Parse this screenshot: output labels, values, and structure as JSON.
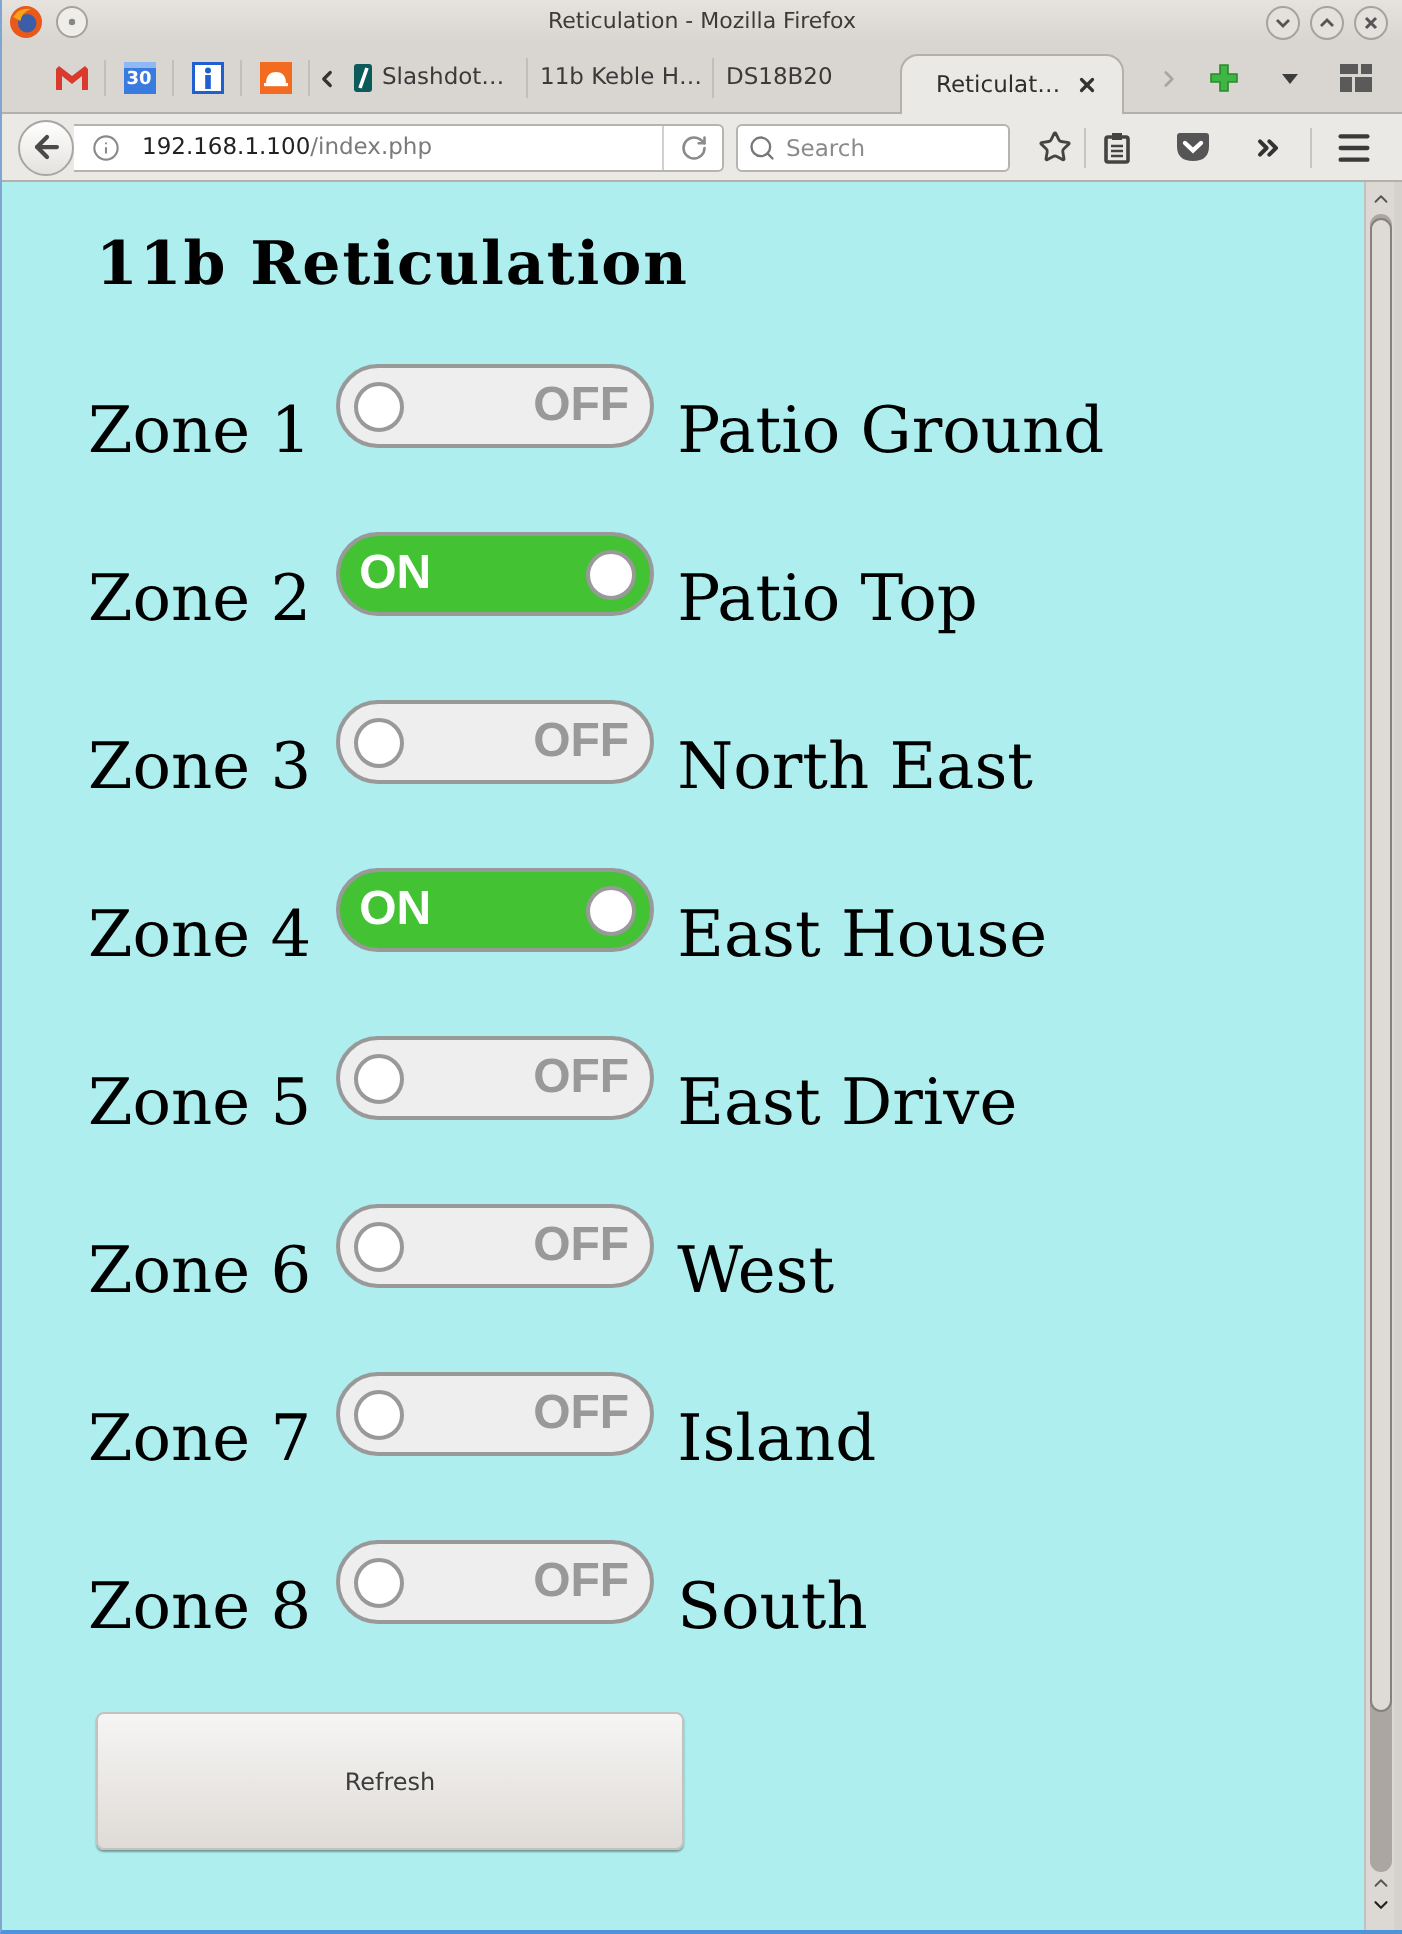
{
  "window": {
    "title": "Reticulation - Mozilla Firefox"
  },
  "pinned_tabs": [
    {
      "kind": "mail"
    },
    {
      "kind": "calendar",
      "label": "30"
    },
    {
      "kind": "info"
    },
    {
      "kind": "helmet"
    }
  ],
  "tabs": [
    {
      "label": "Slashdot…",
      "has_icon": true,
      "selected": false
    },
    {
      "label": "11b Keble H…",
      "has_icon": false,
      "selected": false
    },
    {
      "label": "DS18B20",
      "has_icon": false,
      "selected": false
    },
    {
      "label": "Reticulat…",
      "has_icon": false,
      "selected": true
    }
  ],
  "address_bar": {
    "host": "192.168.1.100",
    "path": "/index.php"
  },
  "search": {
    "placeholder": "Search"
  },
  "page": {
    "heading": "11b Reticulation",
    "zones": [
      {
        "name": "Zone 1",
        "on": false,
        "switch_text": "OFF",
        "label": "Patio Ground"
      },
      {
        "name": "Zone 2",
        "on": true,
        "switch_text": "ON",
        "label": "Patio Top"
      },
      {
        "name": "Zone 3",
        "on": false,
        "switch_text": "OFF",
        "label": "North East"
      },
      {
        "name": "Zone 4",
        "on": true,
        "switch_text": "ON",
        "label": "East House"
      },
      {
        "name": "Zone 5",
        "on": false,
        "switch_text": "OFF",
        "label": "East Drive"
      },
      {
        "name": "Zone 6",
        "on": false,
        "switch_text": "OFF",
        "label": "West"
      },
      {
        "name": "Zone 7",
        "on": false,
        "switch_text": "OFF",
        "label": "Island"
      },
      {
        "name": "Zone 8",
        "on": false,
        "switch_text": "OFF",
        "label": "South"
      }
    ],
    "refresh_button": "Refresh"
  }
}
